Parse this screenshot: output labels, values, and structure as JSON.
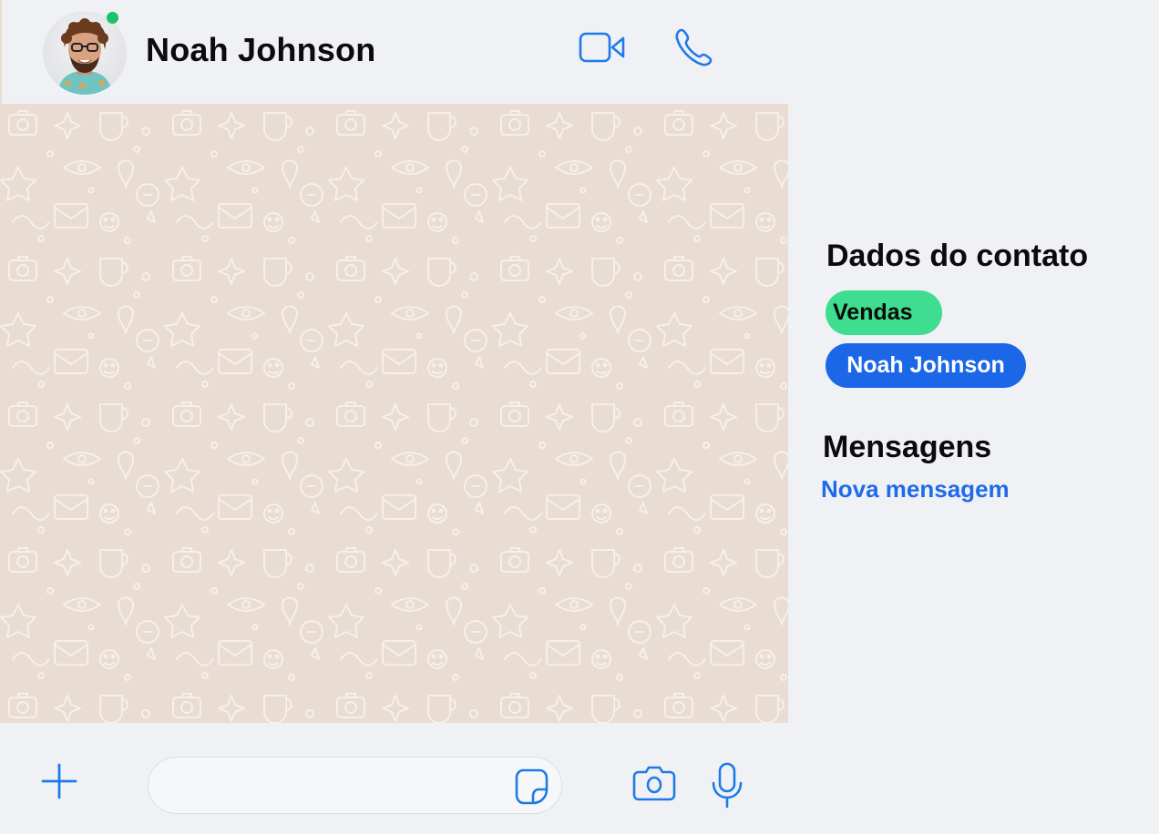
{
  "header": {
    "contact_name": "Noah Johnson",
    "online_status": "online",
    "avatar_icon": "user-photo",
    "video_call_icon": "video-camera-icon",
    "voice_call_icon": "phone-icon"
  },
  "composer": {
    "attach_icon": "plus-icon",
    "message_value": "",
    "message_placeholder": "",
    "sticker_icon": "sticker-icon",
    "camera_icon": "camera-icon",
    "mic_icon": "microphone-icon"
  },
  "side_panel": {
    "contact_section_title": "Dados do contato",
    "tags": [
      {
        "label": "Vendas",
        "color": "#3fdd8f"
      },
      {
        "label": "Noah Johnson",
        "color": "#1b67e8"
      }
    ],
    "messages_section_title": "Mensagens",
    "new_message_link": "Nova mensagem"
  },
  "colors": {
    "accent_blue": "#1f7ae8",
    "online_green": "#19c36b",
    "chat_background": "#e9ddd3",
    "panel_background": "#f0f1f5"
  }
}
